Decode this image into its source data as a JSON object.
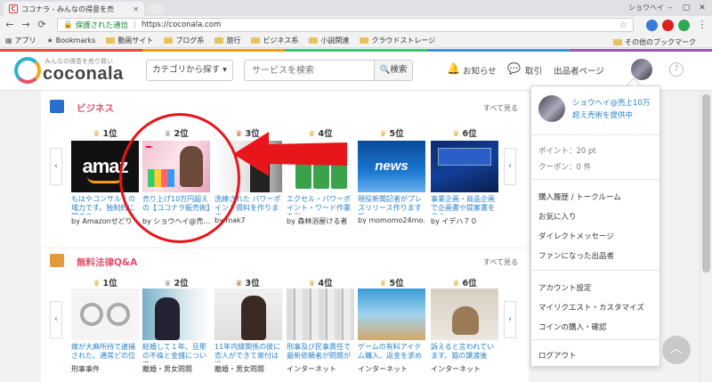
{
  "browser": {
    "tab_title": "ココナラ - みんなの得意を売",
    "tab_favicon": "C",
    "window_user": "ショウヘイ",
    "secure_label": "保護された通信",
    "url": "https://coconala.com",
    "bookmarks": [
      {
        "label": "アプリ",
        "icon": "apps-icon"
      },
      {
        "label": "Bookmarks",
        "icon": "star-icon"
      },
      {
        "label": "動画サイト",
        "icon": "folder-icon"
      },
      {
        "label": "ブログ系",
        "icon": "folder-icon"
      },
      {
        "label": "旅行",
        "icon": "folder-icon"
      },
      {
        "label": "ビジネス系",
        "icon": "folder-icon"
      },
      {
        "label": "小説関連",
        "icon": "folder-icon"
      },
      {
        "label": "クラウドストレージ",
        "icon": "folder-icon"
      }
    ],
    "other_bookmarks": "その他のブックマーク"
  },
  "header": {
    "tagline": "みんなの得意を売り買い",
    "logo": "coconala",
    "category_button": "カテゴリから探す ▾",
    "search_placeholder": "サービスを検索",
    "search_button": "検索",
    "notifications": "お知らせ",
    "trades": "取引",
    "seller_page": "出品者ページ",
    "help": "?"
  },
  "sections": [
    {
      "title": "ビジネス",
      "more": "すべて見る",
      "ranks": [
        "1位",
        "2位",
        "3位",
        "4位",
        "5位",
        "6位"
      ],
      "cards": [
        {
          "title": "もはやコンサル・の域力です。独制約に関する",
          "author": "by Amazonせどり"
        },
        {
          "title": "売り上げ10万円超えの【ココナラ販売術】",
          "author": "by ショウヘイ@売…"
        },
        {
          "title": "洗練された パワーポイント資料を作ります",
          "author": "by mak7"
        },
        {
          "title": "エクセル・パワーポイント・ワード作業を引",
          "author": "by 森林浴屋ける者"
        },
        {
          "title": "現役新聞記者がプレスリリース作ります 新",
          "author": "by momomo24mo…"
        },
        {
          "title": "事業企画・商品企画で企画書や提案書を作ら",
          "author": "by イデハ７０"
        }
      ]
    },
    {
      "title": "無料法律Q&A",
      "more": "すべて見る",
      "ranks": [
        "1位",
        "2位",
        "3位",
        "4位",
        "5位",
        "6位"
      ],
      "cards": [
        {
          "title": "嫁が大麻所持で逮捕された。通常どの位",
          "author": "刑事事件"
        },
        {
          "title": "結婚して１年、旦那の不倫と金銭について",
          "author": "離婚・男女問題"
        },
        {
          "title": "11年内縁関係の彼に恋人ができて寄付は追",
          "author": "離婚・男女問題"
        },
        {
          "title": "刑事及び民事責任で最新依頼者が問題が",
          "author": "インターネット"
        },
        {
          "title": "ゲームの有料アイテム購入、返金を求め",
          "author": "インターネット"
        },
        {
          "title": "訴えると言われています。猫の譲渡後",
          "author": "インターネット"
        }
      ]
    }
  ],
  "dropdown": {
    "user_name": "ショウヘイ@売上10万",
    "user_sub": "超え売術を提供中",
    "points": "ポイント：20 pt",
    "coupons": "クーポン：0 件",
    "items_group1": [
      "購入履歴 / トークルーム",
      "お気に入り",
      "ダイレクトメッセージ",
      "ファンになった出品者"
    ],
    "items_group2": [
      "アカウント設定",
      "マイリクエスト・カスタマイズ",
      "コインの購入・確認"
    ],
    "logout": "ログアウト"
  },
  "colors": {
    "accent_pink": "#e0506a",
    "link_blue": "#2a82c9",
    "annotation_red": "#e8151b",
    "brand_teal": "#2db3c7"
  }
}
